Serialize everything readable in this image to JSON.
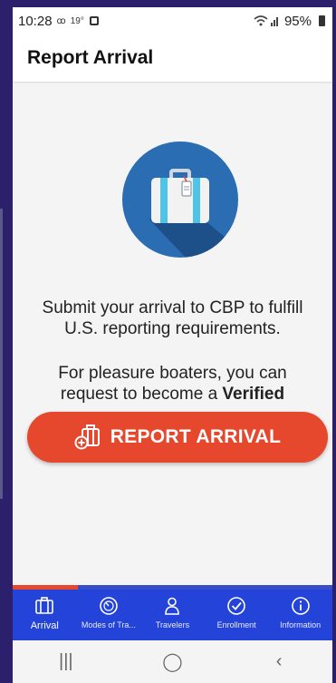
{
  "status_bar": {
    "time": "10:28",
    "indicator_small": "19°",
    "battery": "95%"
  },
  "app_bar": {
    "title": "Report Arrival"
  },
  "main": {
    "message_line1": "Submit your arrival to CBP to fulfill",
    "message_line2": "U.S. reporting requirements.",
    "verified_line1": "For pleasure boaters, you can",
    "verified_line2_prefix": "request to become a ",
    "verified_line2_bold": "Verified",
    "report_button": "REPORT ARRIVAL"
  },
  "bottom_nav": {
    "items": [
      {
        "label": "Arrival",
        "icon": "luggage-icon",
        "active": true
      },
      {
        "label": "Modes of Tra...",
        "icon": "dial-icon",
        "active": false
      },
      {
        "label": "Travelers",
        "icon": "person-icon",
        "active": false
      },
      {
        "label": "Enrollment",
        "icon": "check-circle-icon",
        "active": false
      },
      {
        "label": "Information",
        "icon": "info-icon",
        "active": false
      }
    ]
  },
  "system_nav": {
    "recents": "|||",
    "home": "◯",
    "back": "‹"
  },
  "colors": {
    "accent_red": "#e5482c",
    "nav_blue": "#2443d8",
    "hero_circle": "#2b6db3",
    "suitcase_stripe": "#4fc3e8"
  }
}
